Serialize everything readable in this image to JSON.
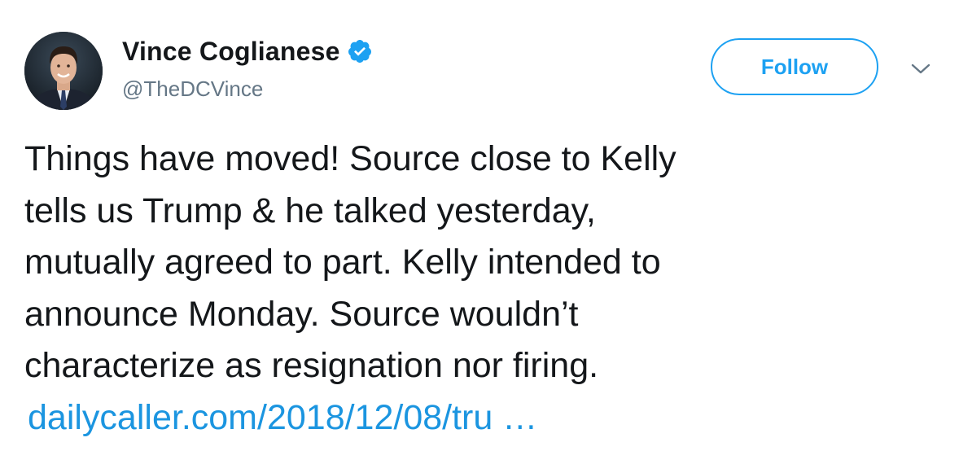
{
  "user": {
    "display_name": "Vince Coglianese",
    "handle": "@TheDCVince",
    "verified_icon": "verified-badge-icon",
    "avatar_icon": "profile-photo"
  },
  "actions": {
    "follow_label": "Follow",
    "menu_icon": "chevron-down-icon"
  },
  "tweet": {
    "lines": [
      "Things have moved! Source close to Kelly",
      "tells us Trump & he talked yesterday,",
      "mutually agreed to part. Kelly intended to",
      "announce Monday. Source wouldn’t",
      "characterize as resignation nor firing."
    ],
    "link_text": "dailycaller.com/2018/12/08/tru …"
  },
  "colors": {
    "accent": "#1da1f2",
    "link": "#1b95e0",
    "text": "#14171a",
    "secondary": "#657786"
  }
}
